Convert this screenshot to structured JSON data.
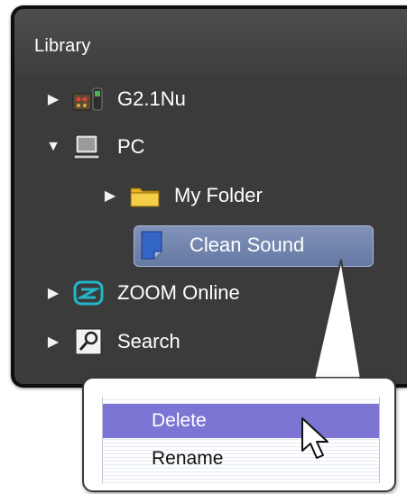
{
  "library": {
    "title": "Library",
    "items": [
      {
        "label": "G2.1Nu",
        "icon": "device-icon",
        "disclosure": "collapsed"
      },
      {
        "label": "PC",
        "icon": "computer-icon",
        "disclosure": "expanded"
      },
      {
        "label": "My Folder",
        "icon": "folder-icon",
        "disclosure": "collapsed"
      },
      {
        "label": "Clean Sound",
        "icon": "patch-file-icon",
        "selected": true
      },
      {
        "label": "ZOOM Online",
        "icon": "zoom-logo-icon",
        "disclosure": "collapsed"
      },
      {
        "label": "Search",
        "icon": "search-icon",
        "disclosure": "collapsed"
      }
    ]
  },
  "context_menu": {
    "items": [
      {
        "label": "Delete",
        "highlighted": true
      },
      {
        "label": "Rename",
        "highlighted": false
      }
    ]
  },
  "colors": {
    "panel_bg": "#3b3b3b",
    "selection": "#7385ad",
    "menu_highlight": "#7d75d3"
  }
}
